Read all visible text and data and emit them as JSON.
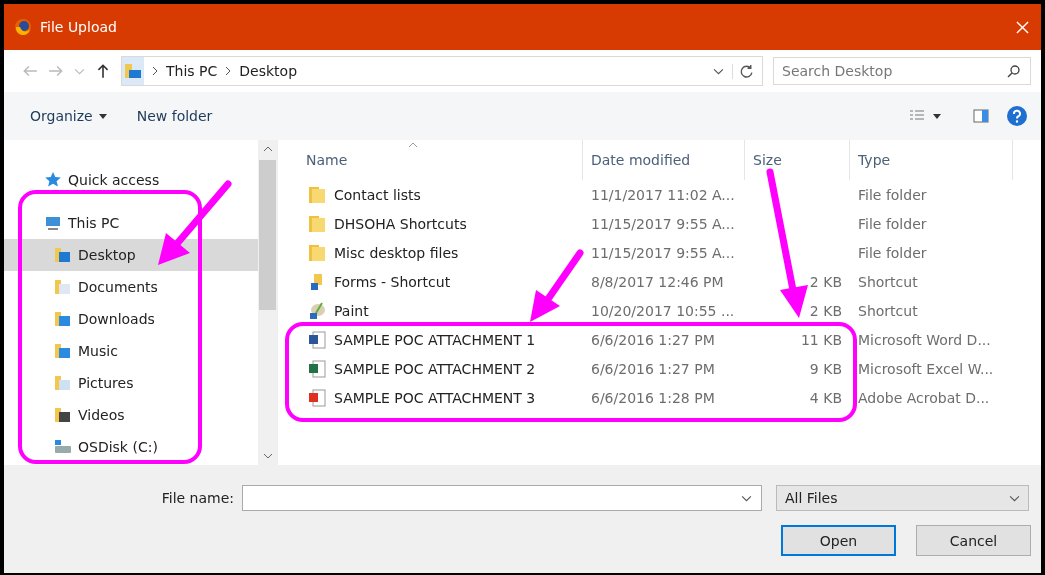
{
  "window": {
    "title": "File Upload"
  },
  "address": {
    "path": [
      "This PC",
      "Desktop"
    ]
  },
  "search": {
    "placeholder": "Search Desktop"
  },
  "toolbar": {
    "organize": "Organize",
    "new_folder": "New folder"
  },
  "nav": {
    "items": [
      {
        "label": "Quick access",
        "kind": "star",
        "selected": false
      },
      {
        "label": "This PC",
        "kind": "pc",
        "selected": false,
        "children": [
          {
            "label": "Desktop",
            "kind": "desktop",
            "selected": true
          },
          {
            "label": "Documents",
            "kind": "documents",
            "selected": false
          },
          {
            "label": "Downloads",
            "kind": "downloads",
            "selected": false
          },
          {
            "label": "Music",
            "kind": "music",
            "selected": false
          },
          {
            "label": "Pictures",
            "kind": "pictures",
            "selected": false
          },
          {
            "label": "Videos",
            "kind": "videos",
            "selected": false
          },
          {
            "label": "OSDisk (C:)",
            "kind": "disk",
            "selected": false
          }
        ]
      }
    ]
  },
  "table": {
    "columns": [
      "Name",
      "Date modified",
      "Size",
      "Type"
    ],
    "rows": [
      {
        "kind": "folder",
        "name": "Contact lists",
        "date": "11/1/2017 11:02 A...",
        "type": "File folder"
      },
      {
        "kind": "folder",
        "name": "DHSOHA Shortcuts",
        "date": "11/15/2017 9:55 A...",
        "type": "File folder"
      },
      {
        "kind": "folder",
        "name": "Misc desktop files",
        "date": "11/15/2017 9:55 A...",
        "type": "File folder"
      },
      {
        "kind": "shortcut",
        "name": "Forms - Shortcut",
        "date": "8/8/2017 12:46 PM",
        "size": "2 KB",
        "type": "Shortcut"
      },
      {
        "kind": "paint",
        "name": "Paint",
        "date": "10/20/2017 10:55 ...",
        "size": "2 KB",
        "type": "Shortcut"
      },
      {
        "kind": "word",
        "name": "SAMPLE POC ATTACHMENT 1",
        "date": "6/6/2016 1:27 PM",
        "size": "11 KB",
        "type": "Microsoft Word D..."
      },
      {
        "kind": "excel",
        "name": "SAMPLE POC ATTACHMENT 2",
        "date": "6/6/2016 1:27 PM",
        "size": "9 KB",
        "type": "Microsoft Excel W..."
      },
      {
        "kind": "pdf",
        "name": "SAMPLE POC ATTACHMENT 3",
        "date": "6/6/2016 1:28 PM",
        "size": "4 KB",
        "type": "Adobe Acrobat D..."
      }
    ]
  },
  "file_name": {
    "label": "File name:"
  },
  "filter": {
    "value": "All Files"
  },
  "buttons": [
    {
      "label": "Open",
      "default": true
    },
    {
      "label": "Cancel",
      "default": false
    }
  ]
}
